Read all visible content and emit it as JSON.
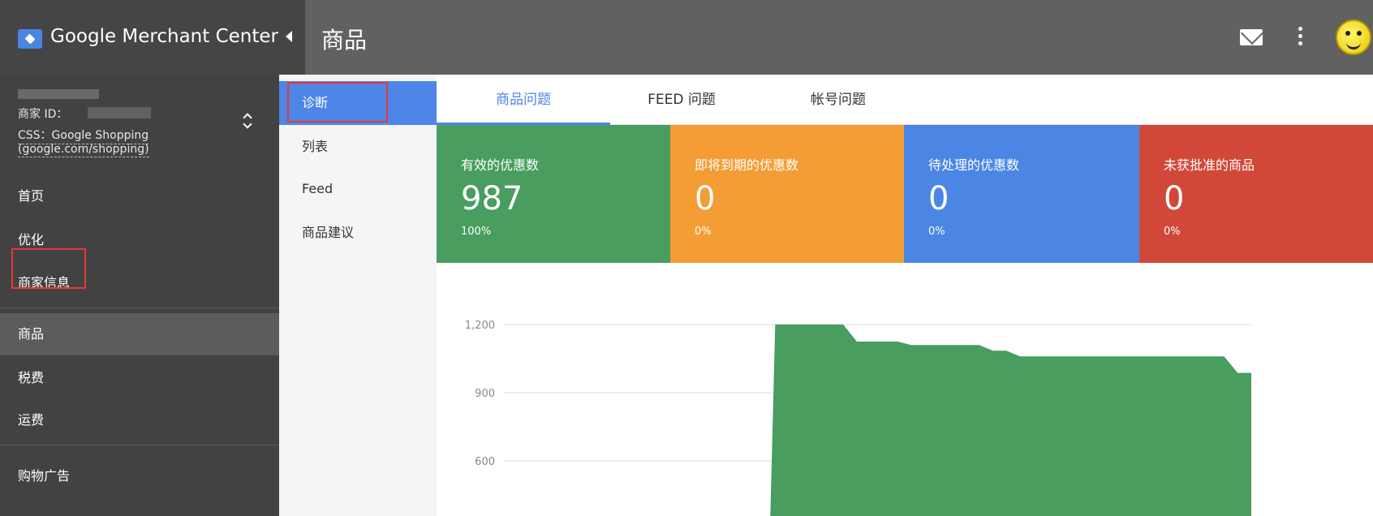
{
  "brand": {
    "name": "Google Merchant Center"
  },
  "header": {
    "title": "商品"
  },
  "icons": {
    "logo": "merchant-center-logo",
    "collapse": "chevron-left-icon",
    "mail": "mail-icon",
    "more": "more-vert-icon",
    "avatar": "smiley-avatar"
  },
  "account": {
    "merchant_id_label": "商家 ID：",
    "css_line1": "CSS：Google Shopping",
    "css_line2": "(google.com/shopping)"
  },
  "sidebar": {
    "items": [
      {
        "label": "首页"
      },
      {
        "label": "优化"
      },
      {
        "label": "商家信息"
      },
      {
        "label": "商品"
      },
      {
        "label": "税费"
      },
      {
        "label": "运费"
      },
      {
        "label": "购物广告"
      }
    ],
    "selected": "商品"
  },
  "subnav": {
    "items": [
      {
        "label": "诊断"
      },
      {
        "label": "列表"
      },
      {
        "label": "Feed"
      },
      {
        "label": "商品建议"
      }
    ],
    "selected": "诊断"
  },
  "tabs": [
    {
      "label": "商品问题"
    },
    {
      "label": "FEED 问题"
    },
    {
      "label": "帐号问题"
    }
  ],
  "kpis": [
    {
      "title": "有效的优惠数",
      "value": "987",
      "percent": "100%",
      "color": "#489d5f"
    },
    {
      "title": "即将到期的优惠数",
      "value": "0",
      "percent": "0%",
      "color": "#f39d34"
    },
    {
      "title": "待处理的优惠数",
      "value": "0",
      "percent": "0%",
      "color": "#4b86e5"
    },
    {
      "title": "未获批准的商品",
      "value": "0",
      "percent": "0%",
      "color": "#d14839"
    }
  ],
  "colors": {
    "accent": "#4d86e6",
    "highlight_border": "#e53935",
    "chart_fill": "#489d5f"
  },
  "chart_data": {
    "type": "area",
    "title": "",
    "xlabel": "",
    "ylabel": "",
    "yticks": [
      1200,
      900,
      600
    ],
    "ytick_labels": [
      "1,200",
      "900",
      "600"
    ],
    "ylim": [
      500,
      1200
    ],
    "grid": true,
    "series": [
      {
        "values": [
          0,
          0,
          0,
          0,
          0,
          0,
          0,
          0,
          0,
          0,
          0,
          0,
          0,
          0,
          0,
          0,
          0,
          0,
          0,
          0,
          1200,
          1200,
          1200,
          1200,
          1200,
          1200,
          1125,
          1125,
          1125,
          1125,
          1110,
          1110,
          1110,
          1110,
          1110,
          1110,
          1085,
          1085,
          1060,
          1060,
          1060,
          1060,
          1060,
          1060,
          1060,
          1060,
          1060,
          1060,
          1060,
          1060,
          1060,
          1060,
          1060,
          1060,
          987,
          987
        ]
      }
    ]
  }
}
